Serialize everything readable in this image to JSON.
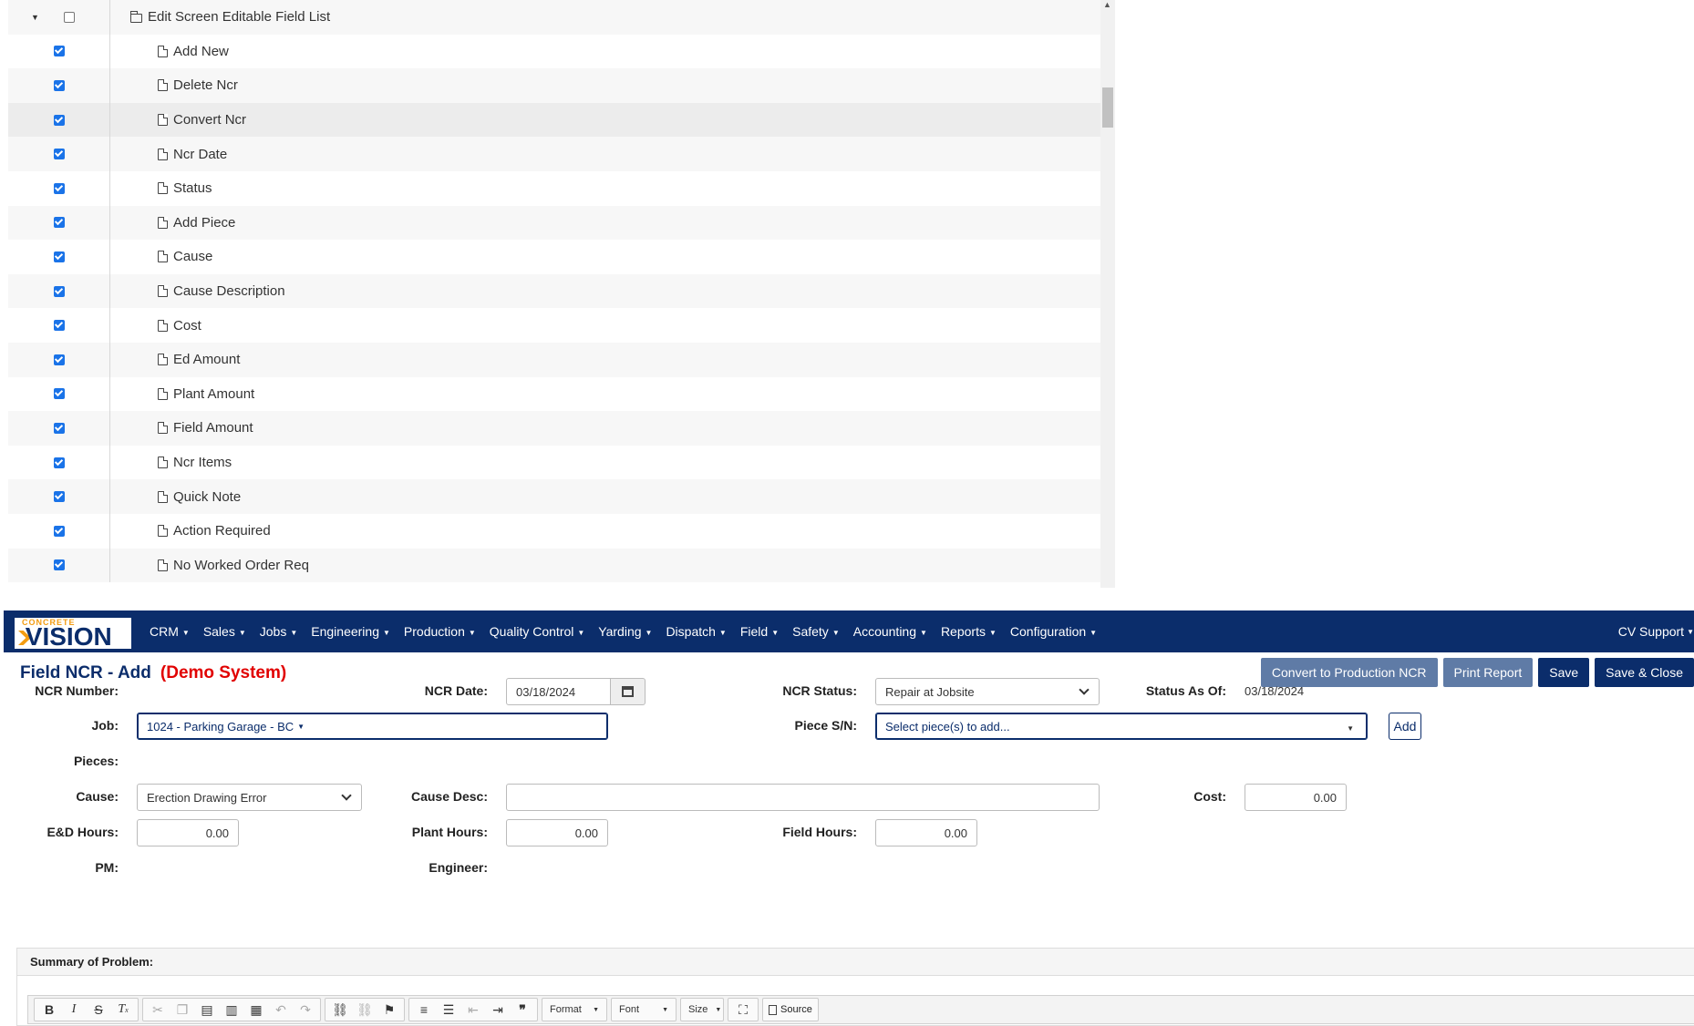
{
  "tree": {
    "parent": {
      "label": "Edit Screen Editable Field List",
      "checked": false,
      "expanded": true
    },
    "children": [
      {
        "label": "Add New",
        "checked": true
      },
      {
        "label": "Delete Ncr",
        "checked": true
      },
      {
        "label": "Convert Ncr",
        "checked": true,
        "highlighted": true
      },
      {
        "label": "Ncr Date",
        "checked": true
      },
      {
        "label": "Status",
        "checked": true
      },
      {
        "label": "Add Piece",
        "checked": true
      },
      {
        "label": "Cause",
        "checked": true
      },
      {
        "label": "Cause Description",
        "checked": true
      },
      {
        "label": "Cost",
        "checked": true
      },
      {
        "label": "Ed Amount",
        "checked": true
      },
      {
        "label": "Plant Amount",
        "checked": true
      },
      {
        "label": "Field Amount",
        "checked": true
      },
      {
        "label": "Ncr Items",
        "checked": true
      },
      {
        "label": "Quick Note",
        "checked": true
      },
      {
        "label": "Action Required",
        "checked": true
      },
      {
        "label": "No Worked Order Req",
        "checked": true
      }
    ]
  },
  "navbar": {
    "logo_small": "CONCRETE",
    "logo_big": "VISION",
    "items": [
      "CRM",
      "Sales",
      "Jobs",
      "Engineering",
      "Production",
      "Quality Control",
      "Yarding",
      "Dispatch",
      "Field",
      "Safety",
      "Accounting",
      "Reports",
      "Configuration"
    ],
    "user": "CV Support",
    "brand_color": "#0b2d6b",
    "accent_color": "#f39c12"
  },
  "page": {
    "title": "Field NCR - Add",
    "demo_label": "(Demo System)"
  },
  "buttons": {
    "convert": "Convert to Production NCR",
    "print": "Print Report",
    "save": "Save",
    "save_close": "Save & Close"
  },
  "form": {
    "ncr_number": {
      "label": "NCR Number:",
      "value": ""
    },
    "ncr_date": {
      "label": "NCR Date:",
      "value": "03/18/2024"
    },
    "ncr_status": {
      "label": "NCR Status:",
      "value": "Repair at Jobsite"
    },
    "status_as_of": {
      "label": "Status As Of:",
      "value": "03/18/2024"
    },
    "job": {
      "label": "Job:",
      "value": "1024 - Parking Garage - BC"
    },
    "piece_sn": {
      "label": "Piece S/N:",
      "placeholder": "Select piece(s) to add...",
      "add_label": "Add"
    },
    "pieces": {
      "label": "Pieces:"
    },
    "cause": {
      "label": "Cause:",
      "value": "Erection Drawing Error"
    },
    "cause_desc": {
      "label": "Cause Desc:",
      "value": ""
    },
    "cost": {
      "label": "Cost:",
      "value": "0.00"
    },
    "ed_hours": {
      "label": "E&D Hours:",
      "value": "0.00"
    },
    "plant_hours": {
      "label": "Plant Hours:",
      "value": "0.00"
    },
    "field_hours": {
      "label": "Field Hours:",
      "value": "0.00"
    },
    "pm": {
      "label": "PM:"
    },
    "engineer": {
      "label": "Engineer:"
    }
  },
  "summary": {
    "heading": "Summary of Problem:",
    "toolbar": {
      "format": "Format",
      "font": "Font",
      "size": "Size",
      "source": "Source"
    }
  }
}
